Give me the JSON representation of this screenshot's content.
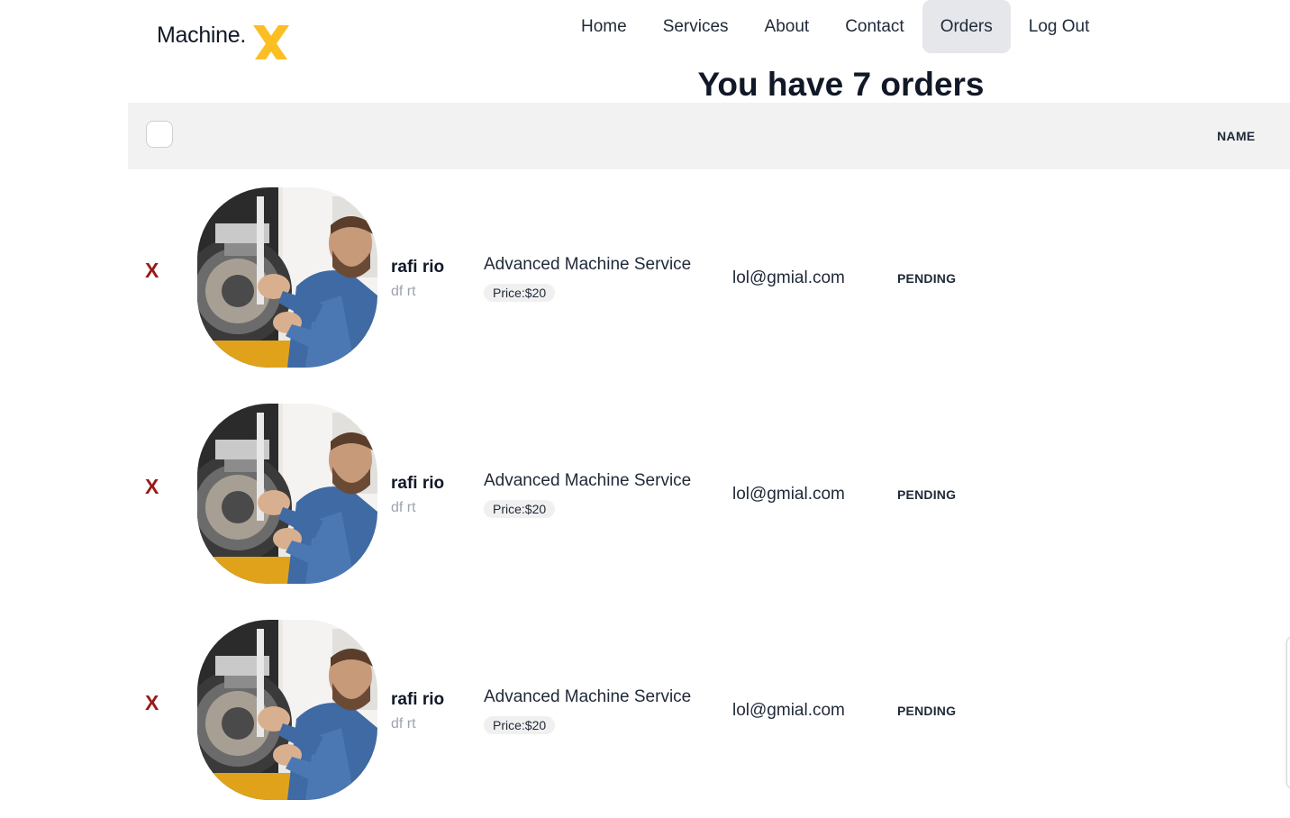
{
  "brand": {
    "name": "Machine.",
    "mark": "X",
    "accent_color": "#fbbf24"
  },
  "nav": {
    "items": [
      {
        "label": "Home",
        "active": false
      },
      {
        "label": "Services",
        "active": false
      },
      {
        "label": "About",
        "active": false
      },
      {
        "label": "Contact",
        "active": false
      },
      {
        "label": "Orders",
        "active": true
      },
      {
        "label": "Log Out",
        "active": false
      }
    ]
  },
  "page": {
    "title": "You have 7 orders"
  },
  "table": {
    "header": {
      "name_label": "NAME"
    },
    "rows": [
      {
        "delete_label": "X",
        "image_icon": "mechanic-photo",
        "customer_name": "rafi rio",
        "customer_address": "df rt",
        "service": "Advanced Machine Service",
        "price": "Price:$20",
        "email": "lol@gmial.com",
        "status": "PENDING"
      },
      {
        "delete_label": "X",
        "image_icon": "mechanic-photo",
        "customer_name": "rafi rio",
        "customer_address": "df rt",
        "service": "Advanced Machine Service",
        "price": "Price:$20",
        "email": "lol@gmial.com",
        "status": "PENDING"
      },
      {
        "delete_label": "X",
        "image_icon": "mechanic-photo",
        "customer_name": "rafi rio",
        "customer_address": "df rt",
        "service": "Advanced Machine Service",
        "price": "Price:$20",
        "email": "lol@gmial.com",
        "status": "PENDING"
      }
    ]
  },
  "colors": {
    "delete": "#991b1b",
    "header_bg": "#f2f2f2",
    "active_nav_bg": "#e5e7eb"
  }
}
